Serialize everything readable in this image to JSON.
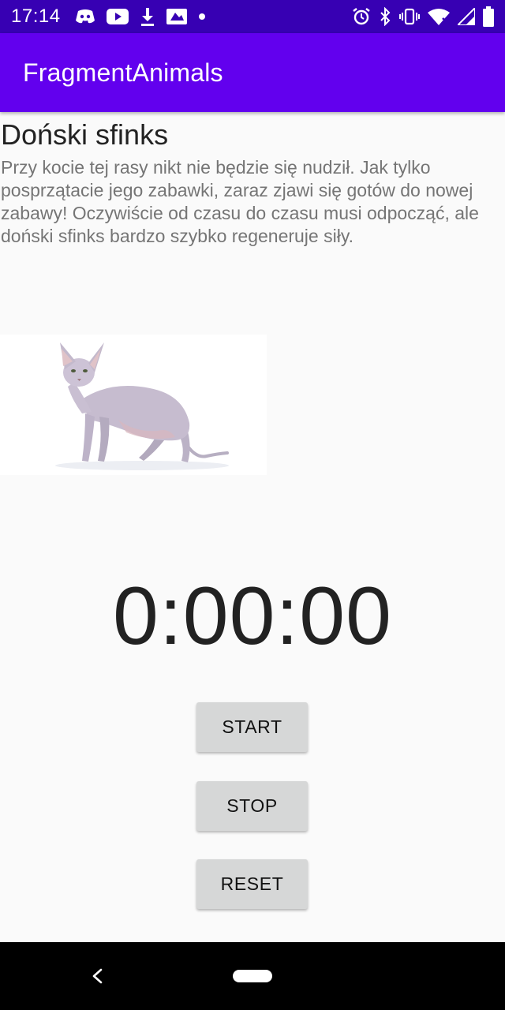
{
  "status_bar": {
    "time": "17:14",
    "left_icons": [
      "discord-icon",
      "youtube-icon",
      "download-icon",
      "news-icon",
      "dot-icon"
    ],
    "right_icons": [
      "alarm-icon",
      "bluetooth-icon",
      "vibrate-icon",
      "wifi-icon",
      "signal-icon",
      "battery-icon"
    ]
  },
  "app_bar": {
    "title": "FragmentAnimals",
    "color": "#6200ee"
  },
  "animal": {
    "name": "Doński sfinks",
    "description": "Przy kocie tej rasy nikt nie będzie się nudził. Jak tylko posprzątacie jego zabawki, zaraz zjawi się gotów do nowej zabawy! Oczywiście od czasu do czasu musi odpocząć, ale doński sfinks bardzo szybko regeneruje siły.",
    "image": "hairless-cat-photo"
  },
  "stopwatch": {
    "display": "0:00:00",
    "start_label": "START",
    "stop_label": "STOP",
    "reset_label": "RESET"
  },
  "nav_bar": {
    "icons": [
      "back-icon",
      "home-pill-icon"
    ]
  },
  "colors": {
    "status_bar": "#3700b3",
    "app_bar": "#6200ee",
    "button": "#d6d7d7"
  }
}
